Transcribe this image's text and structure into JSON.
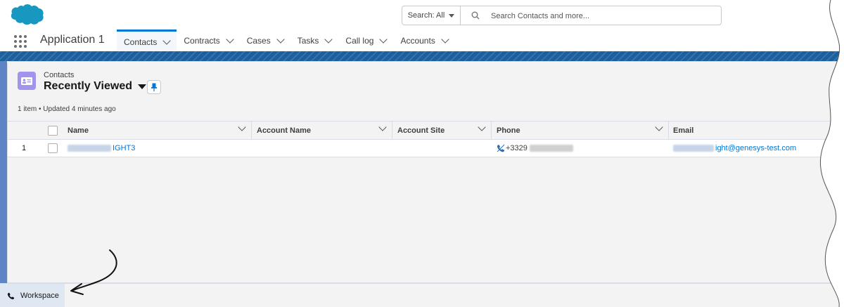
{
  "colors": {
    "accent": "#0176d3",
    "brand_cloud": "#1798c1",
    "banner": "#1b5f9e",
    "contacts_icon": "#a094ed"
  },
  "search": {
    "scope_label": "Search: All",
    "placeholder": "Search Contacts and more..."
  },
  "nav": {
    "app_name": "Application 1",
    "tabs": [
      {
        "label": "Contacts",
        "active": true
      },
      {
        "label": "Contracts",
        "active": false
      },
      {
        "label": "Cases",
        "active": false
      },
      {
        "label": "Tasks",
        "active": false
      },
      {
        "label": "Call log",
        "active": false
      },
      {
        "label": "Accounts",
        "active": false
      }
    ]
  },
  "list": {
    "object_label": "Contacts",
    "view_name": "Recently Viewed",
    "meta": "1 item • Updated 4 minutes ago",
    "columns": [
      "Name",
      "Account Name",
      "Account Site",
      "Phone",
      "Email"
    ],
    "rows": [
      {
        "index": "1",
        "name": "IGHT3",
        "account_name": "",
        "account_site": "",
        "phone": "+3329",
        "email": "ight@genesys-test.com"
      }
    ]
  },
  "footer": {
    "workspace_label": "Workspace"
  }
}
